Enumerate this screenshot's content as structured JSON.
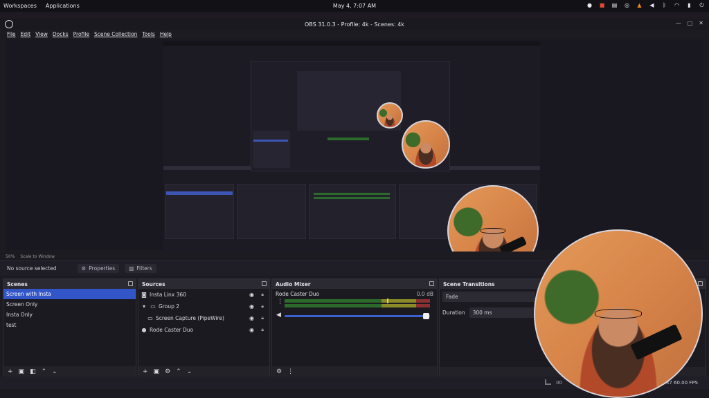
{
  "top_panel": {
    "workspaces": "Workspaces",
    "applications": "Applications",
    "clock": "May 4, 7:07 AM",
    "tray_icons": [
      "chrome-icon",
      "record-icon",
      "note-icon",
      "steam-icon",
      "vlc-icon",
      "volume-icon",
      "bluetooth-icon",
      "wifi-icon",
      "battery-icon",
      "power-icon"
    ]
  },
  "window": {
    "title": "OBS 31.0.3 - Profile: 4k - Scenes: 4k",
    "controls": [
      "—",
      "□",
      "✕"
    ]
  },
  "menu": [
    "File",
    "Edit",
    "View",
    "Docks",
    "Profile",
    "Scene Collection",
    "Tools",
    "Help"
  ],
  "preview": {
    "scale_label": "50%",
    "scale_mode": "Scale to Window"
  },
  "context_bar": {
    "selection": "No source selected",
    "properties": "Properties",
    "filters": "Filters"
  },
  "scenes": {
    "title": "Scenes",
    "items": [
      {
        "label": "Screen with Insta",
        "selected": true
      },
      {
        "label": "Screen Only",
        "selected": false
      },
      {
        "label": "Insta Only",
        "selected": false
      },
      {
        "label": "test",
        "selected": false
      }
    ]
  },
  "sources": {
    "title": "Sources",
    "items": [
      {
        "label": "Insta Linx 360",
        "icon": "camera-icon"
      },
      {
        "label": "Group 2",
        "icon": "folder-icon"
      },
      {
        "label": "Screen Capture (PipeWire)",
        "icon": "monitor-icon"
      },
      {
        "label": "Rode Caster Duo",
        "icon": "mic-icon"
      }
    ]
  },
  "mixer": {
    "title": "Audio Mixer",
    "channel": "Rode Caster Duo",
    "level": "0.0 dB",
    "volume": 0.97
  },
  "transitions": {
    "title": "Scene Transitions",
    "type": "Fade",
    "duration_label": "Duration",
    "duration_value": "300 ms"
  },
  "status": {
    "rec": "00",
    "fps": ".37 60.00 FPS"
  },
  "colors": {
    "accent": "#3256c7",
    "meter_green": "#2c6a2c"
  }
}
